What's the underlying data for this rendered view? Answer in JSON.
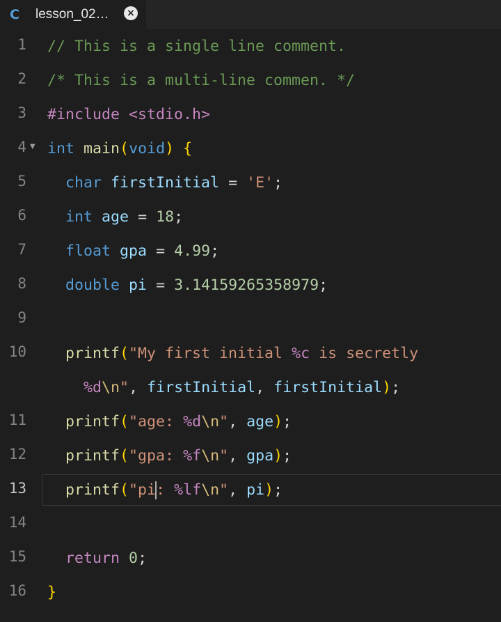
{
  "tab": {
    "icon": "C",
    "title": "lesson_02…",
    "close": "×"
  },
  "lines": [
    {
      "n": "1"
    },
    {
      "n": "2"
    },
    {
      "n": "3"
    },
    {
      "n": "4"
    },
    {
      "n": "5"
    },
    {
      "n": "6"
    },
    {
      "n": "7"
    },
    {
      "n": "8"
    },
    {
      "n": "9"
    },
    {
      "n": "10"
    },
    {
      "n": "11"
    },
    {
      "n": "12"
    },
    {
      "n": "13"
    },
    {
      "n": "14"
    },
    {
      "n": "15"
    },
    {
      "n": "16"
    }
  ],
  "code": {
    "l1": "// This is a single line comment.",
    "l2": "/* This is a multi-line commen. */",
    "l3_inc": "#include",
    "l3_hdr": "<stdio.h>",
    "l4_int": "int",
    "l4_main": "main",
    "l4_void": "void",
    "l5_type": "char",
    "l5_var": "firstInitial",
    "l5_val": "'E'",
    "l6_type": "int",
    "l6_var": "age",
    "l6_val": "18",
    "l7_type": "float",
    "l7_var": "gpa",
    "l7_val": "4.99",
    "l8_type": "double",
    "l8_var": "pi",
    "l8_val": "3.14159265358979",
    "l10_fn": "printf",
    "l10_str": "\"My first initial ",
    "l10_fmt1": "%c",
    "l10_str2": " is secretly",
    "l10b_fmt": "%d",
    "l10b_esc": "\\n",
    "l10b_q": "\"",
    "l10b_var1": "firstInitial",
    "l10b_var2": "firstInitial",
    "l11_fn": "printf",
    "l11_str": "\"age: ",
    "l11_fmt": "%d",
    "l11_esc": "\\n",
    "l11_q": "\"",
    "l11_var": "age",
    "l12_fn": "printf",
    "l12_str": "\"gpa: ",
    "l12_fmt": "%f",
    "l12_esc": "\\n",
    "l12_q": "\"",
    "l12_var": "gpa",
    "l13_fn": "printf",
    "l13_str_a": "\"pi",
    "l13_str_b": ": ",
    "l13_fmt": "%lf",
    "l13_esc": "\\n",
    "l13_q": "\"",
    "l13_var": "pi",
    "l15_ret": "return",
    "l15_val": "0"
  }
}
